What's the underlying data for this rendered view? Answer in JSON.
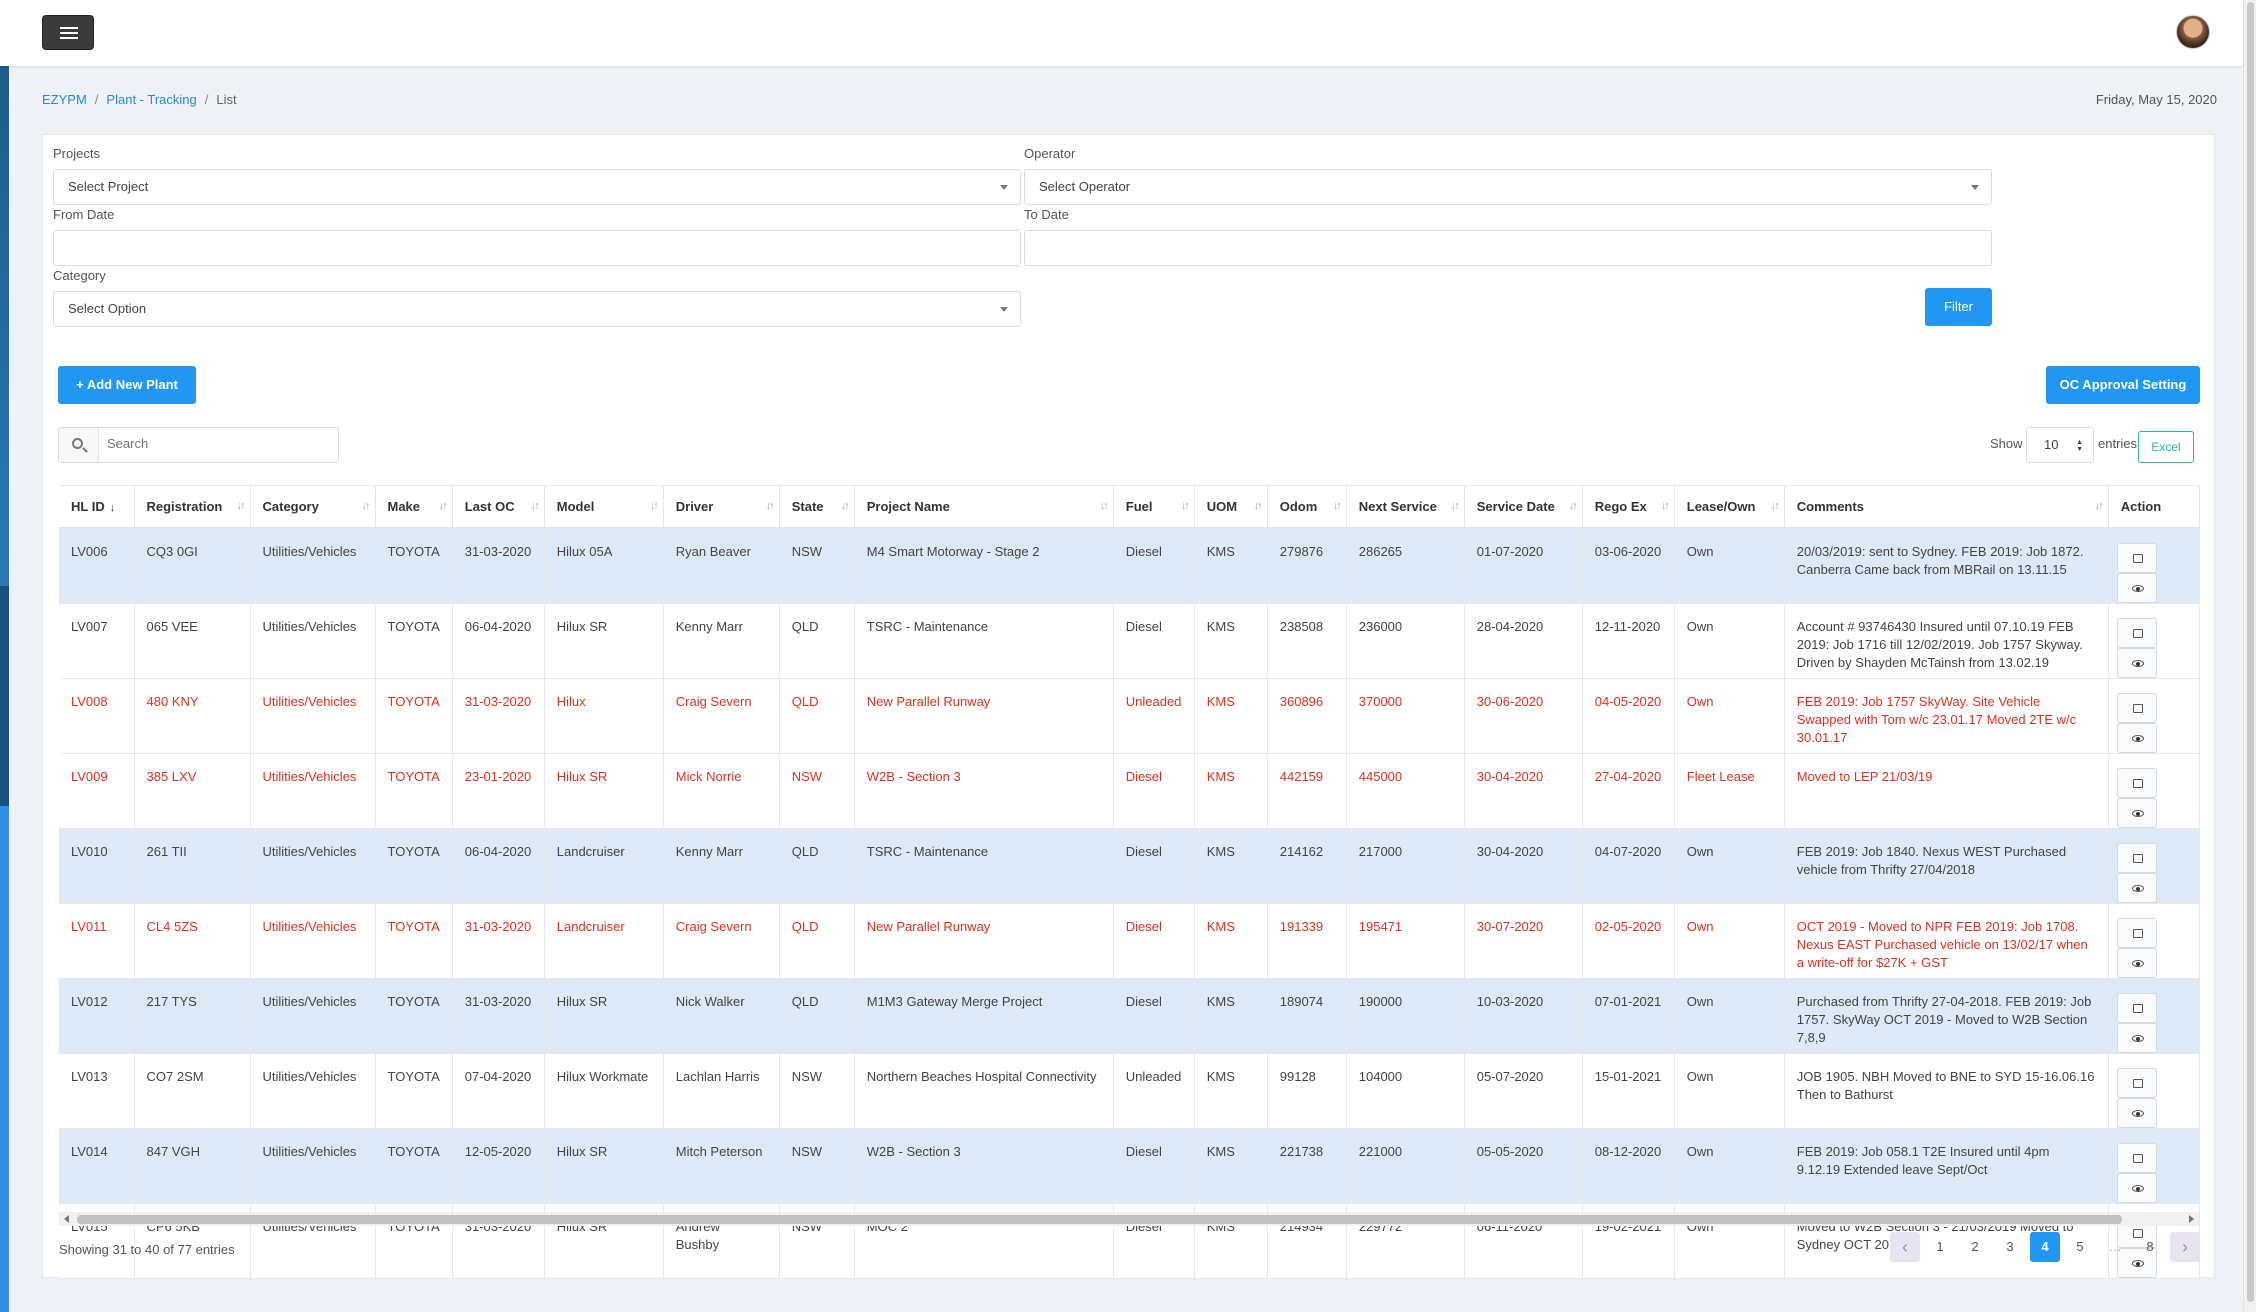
{
  "topbar": {
    "menu_icon": "hamburger-icon",
    "avatar_icon": "user-avatar"
  },
  "breadcrumb": {
    "root": "EZYPM",
    "section": "Plant - Tracking",
    "current": "List",
    "separator": "/"
  },
  "date": "Friday, May 15, 2020",
  "filters": {
    "projects_label": "Projects",
    "projects_value": "Select Project",
    "operator_label": "Operator",
    "operator_value": "Select Operator",
    "from_date_label": "From Date",
    "from_date_value": "",
    "to_date_label": "To Date",
    "to_date_value": "",
    "category_label": "Category",
    "category_value": "Select Option",
    "filter_button": "Filter"
  },
  "actions": {
    "add_plant": "+ Add New Plant",
    "oc_approval": "OC Approval Setting"
  },
  "table_tools": {
    "search_placeholder": "Search",
    "show_label": "Show",
    "page_length": "10",
    "entries_label": "entries",
    "excel_button": "Excel"
  },
  "columns": [
    "HL ID",
    "Registration",
    "Category",
    "Make",
    "Last OC",
    "Model",
    "Driver",
    "State",
    "Project Name",
    "Fuel",
    "UOM",
    "Odom",
    "Next Service",
    "Service Date",
    "Rego Ex",
    "Lease/Own",
    "Comments",
    "Action"
  ],
  "rows": [
    {
      "style": "odd",
      "cells": [
        "LV006",
        "CQ3 0GI",
        "Utilities/Vehicles",
        "TOYOTA",
        "31-03-2020",
        "Hilux 05A",
        "Ryan Beaver",
        "NSW",
        "M4 Smart Motorway - Stage 2",
        "Diesel",
        "KMS",
        "279876",
        "286265",
        "01-07-2020",
        "03-06-2020",
        "Own",
        "20/03/2019: sent to Sydney. FEB 2019: Job 1872. Canberra Came back from MBRail on 13.11.15"
      ]
    },
    {
      "style": "even",
      "cells": [
        "LV007",
        "065 VEE",
        "Utilities/Vehicles",
        "TOYOTA",
        "06-04-2020",
        "Hilux SR",
        "Kenny Marr",
        "QLD",
        "TSRC - Maintenance",
        "Diesel",
        "KMS",
        "238508",
        "236000",
        "28-04-2020",
        "12-11-2020",
        "Own",
        "Account # 93746430 Insured until 07.10.19 FEB 2019: Job 1716 till 12/02/2019. Job 1757 Skyway. Driven by Shayden McTainsh from 13.02.19"
      ]
    },
    {
      "style": "red-even",
      "cells": [
        "LV008",
        "480 KNY",
        "Utilities/Vehicles",
        "TOYOTA",
        "31-03-2020",
        "Hilux",
        "Craig Severn",
        "QLD",
        "New Parallel Runway",
        "Unleaded",
        "KMS",
        "360896",
        "370000",
        "30-06-2020",
        "04-05-2020",
        "Own",
        "FEB 2019: Job 1757 SkyWay. Site Vehicle Swapped with Tom w/c 23.01.17 Moved 2TE w/c 30.01.17"
      ]
    },
    {
      "style": "red-even",
      "cells": [
        "LV009",
        "385 LXV",
        "Utilities/Vehicles",
        "TOYOTA",
        "23-01-2020",
        "Hilux SR",
        "Mick Norrie",
        "NSW",
        "W2B - Section 3",
        "Diesel",
        "KMS",
        "442159",
        "445000",
        "30-04-2020",
        "27-04-2020",
        "Fleet Lease",
        "Moved to LEP 21/03/19"
      ]
    },
    {
      "style": "odd",
      "cells": [
        "LV010",
        "261 TII",
        "Utilities/Vehicles",
        "TOYOTA",
        "06-04-2020",
        "Landcruiser",
        "Kenny Marr",
        "QLD",
        "TSRC - Maintenance",
        "Diesel",
        "KMS",
        "214162",
        "217000",
        "30-04-2020",
        "04-07-2020",
        "Own",
        "FEB 2019: Job 1840. Nexus WEST Purchased vehicle from Thrifty 27/04/2018"
      ]
    },
    {
      "style": "red-even",
      "cells": [
        "LV011",
        "CL4 5ZS",
        "Utilities/Vehicles",
        "TOYOTA",
        "31-03-2020",
        "Landcruiser",
        "Craig Severn",
        "QLD",
        "New Parallel Runway",
        "Diesel",
        "KMS",
        "191339",
        "195471",
        "30-07-2020",
        "02-05-2020",
        "Own",
        "OCT 2019 - Moved to NPR FEB 2019: Job 1708. Nexus EAST Purchased vehicle on 13/02/17 when a write-off for $27K + GST"
      ]
    },
    {
      "style": "odd",
      "cells": [
        "LV012",
        "217 TYS",
        "Utilities/Vehicles",
        "TOYOTA",
        "31-03-2020",
        "Hilux SR",
        "Nick Walker",
        "QLD",
        "M1M3 Gateway Merge Project",
        "Diesel",
        "KMS",
        "189074",
        "190000",
        "10-03-2020",
        "07-01-2021",
        "Own",
        "Purchased from Thrifty 27-04-2018. FEB 2019: Job 1757. SkyWay OCT 2019 - Moved to W2B Section 7,8,9"
      ]
    },
    {
      "style": "even",
      "cells": [
        "LV013",
        "CO7 2SM",
        "Utilities/Vehicles",
        "TOYOTA",
        "07-04-2020",
        "Hilux Workmate",
        "Lachlan Harris",
        "NSW",
        "Northern Beaches Hospital Connectivity",
        "Unleaded",
        "KMS",
        "99128",
        "104000",
        "05-07-2020",
        "15-01-2021",
        "Own",
        "JOB 1905. NBH Moved to BNE to SYD 15-16.06.16 Then to Bathurst"
      ]
    },
    {
      "style": "odd",
      "cells": [
        "LV014",
        "847 VGH",
        "Utilities/Vehicles",
        "TOYOTA",
        "12-05-2020",
        "Hilux SR",
        "Mitch Peterson",
        "NSW",
        "W2B - Section 3",
        "Diesel",
        "KMS",
        "221738",
        "221000",
        "05-05-2020",
        "08-12-2020",
        "Own",
        "FEB 2019: Job 058.1 T2E Insured until 4pm 9.12.19 Extended leave Sept/Oct"
      ]
    },
    {
      "style": "even",
      "cells": [
        "LV015",
        "CP6 5KB",
        "Utilities/Vehicles",
        "TOYOTA",
        "31-03-2020",
        "Hilux SR",
        "Andrew Bushby",
        "NSW",
        "MOC 2",
        "Diesel",
        "KMS",
        "214934",
        "229772",
        "06-11-2020",
        "19-02-2021",
        "Own",
        "Moved to W2B Section 3 - 21/03/2019 Moved to Sydney OCT 2019"
      ]
    }
  ],
  "row_action_icons": [
    "edit-icon",
    "view-icon"
  ],
  "table_info": "Showing 31 to 40 of 77 entries",
  "pagination": {
    "prev": "‹",
    "next": "›",
    "pages": [
      "1",
      "2",
      "3",
      "4",
      "5",
      "…",
      "8"
    ],
    "active": "4"
  }
}
